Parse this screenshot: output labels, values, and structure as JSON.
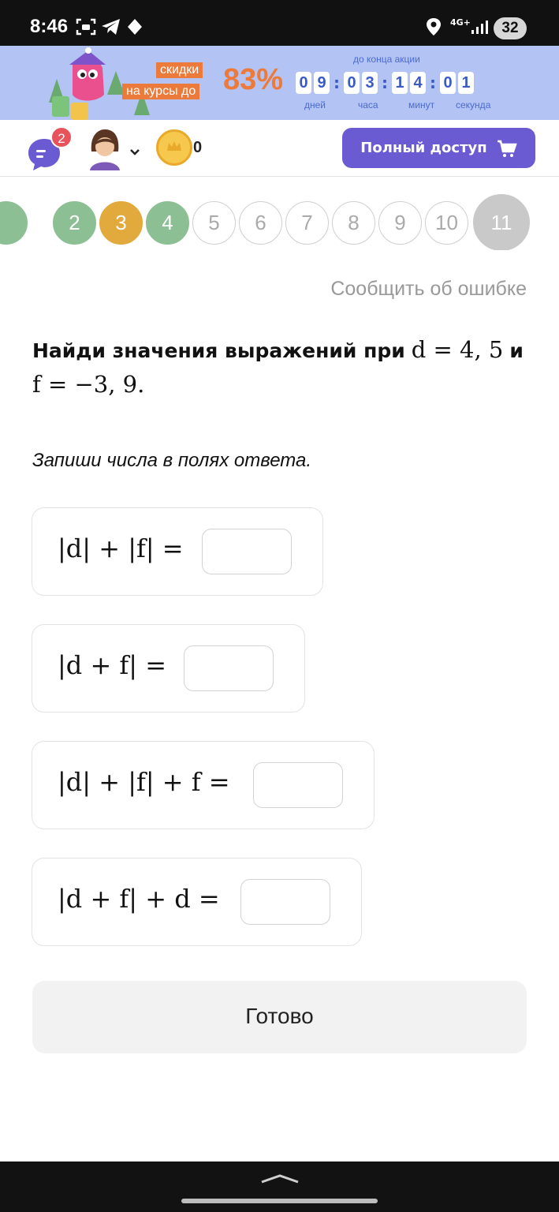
{
  "status_bar": {
    "time": "8:46",
    "network": "4G+",
    "battery": "32"
  },
  "promo": {
    "tag_line1": "скидки",
    "tag_line2": "на курсы до",
    "percent": "83%",
    "countdown_caption": "до конца акции",
    "countdown": {
      "days": [
        "0",
        "9"
      ],
      "hours": [
        "0",
        "3"
      ],
      "minutes": [
        "1",
        "4"
      ],
      "seconds": [
        "0",
        "1"
      ]
    },
    "labels": {
      "days": "дней",
      "hours": "часа",
      "minutes": "минут",
      "seconds": "секунда"
    }
  },
  "header": {
    "chat_badge": "2",
    "coins": "0",
    "full_access": "Полный доступ"
  },
  "steps": [
    {
      "label": "2",
      "state": "done"
    },
    {
      "label": "3",
      "state": "wrong"
    },
    {
      "label": "4",
      "state": "done"
    },
    {
      "label": "5",
      "state": "todo"
    },
    {
      "label": "6",
      "state": "todo"
    },
    {
      "label": "7",
      "state": "todo"
    },
    {
      "label": "8",
      "state": "todo"
    },
    {
      "label": "9",
      "state": "todo"
    },
    {
      "label": "10",
      "state": "todo"
    },
    {
      "label": "11",
      "state": "current"
    }
  ],
  "report_error": "Сообщить об ошибке",
  "question": {
    "prefix": "Найди значения выражений при",
    "var1": "d = 4, 5",
    "and": "и",
    "var2": "f = −3, 9."
  },
  "instruction": "Запиши числа в полях ответа.",
  "expressions": [
    "|d| + |f| =",
    "|d + f| =",
    "|d| + |f| + f =",
    "|d + f| + d ="
  ],
  "answers": [
    "",
    "",
    "",
    ""
  ],
  "done_button": "Готово",
  "colors": {
    "accent": "#6b5bd2",
    "done_step": "#8dbf95",
    "wrong_step": "#e2a93c",
    "promo_bg": "#b3c3f4",
    "promo_orange": "#ec7a3a"
  }
}
